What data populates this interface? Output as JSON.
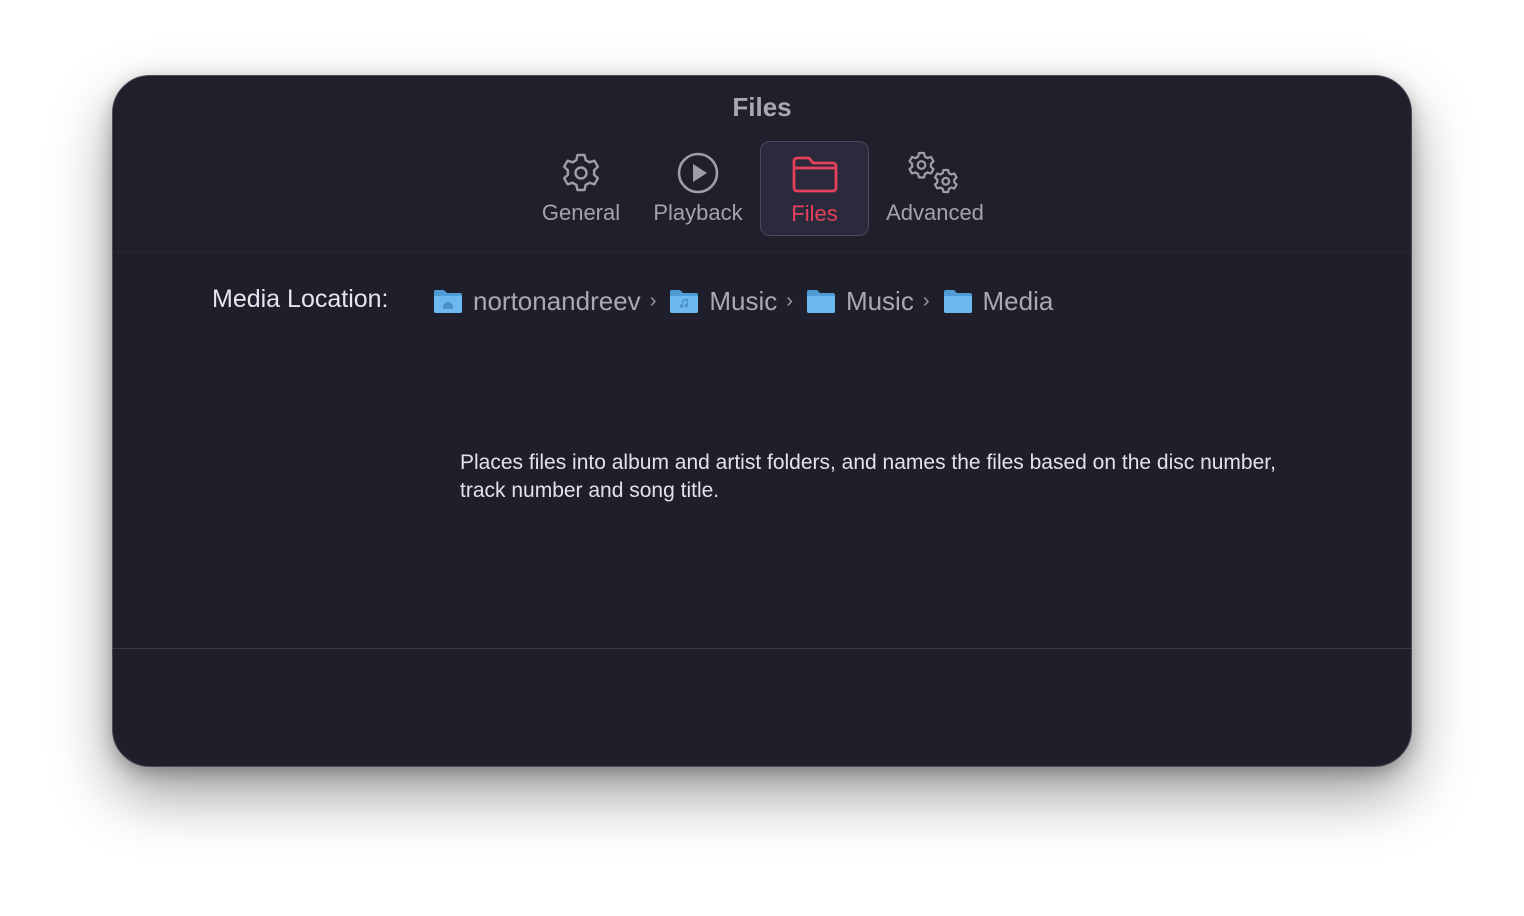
{
  "window": {
    "title": "Files"
  },
  "toolbar": {
    "tabs": [
      {
        "label": "General",
        "icon": "gear-icon"
      },
      {
        "label": "Playback",
        "icon": "play-circle-icon"
      },
      {
        "label": "Files",
        "icon": "folder-icon",
        "selected": true
      },
      {
        "label": "Advanced",
        "icon": "gears-icon"
      }
    ]
  },
  "media_location": {
    "label": "Media Location:",
    "path": [
      {
        "name": "nortonandreev",
        "icon": "home-folder-icon"
      },
      {
        "name": "Music",
        "icon": "music-folder-icon"
      },
      {
        "name": "Music",
        "icon": "folder-icon"
      },
      {
        "name": "Media",
        "icon": "folder-icon"
      }
    ],
    "separator": "›"
  },
  "description": "Places files into album and artist folders, and names the files based on the disc number, track number and song title.",
  "colors": {
    "accent": "#e5415a",
    "background": "#1f1f2b",
    "folder_blue": "#5fb1ea"
  }
}
